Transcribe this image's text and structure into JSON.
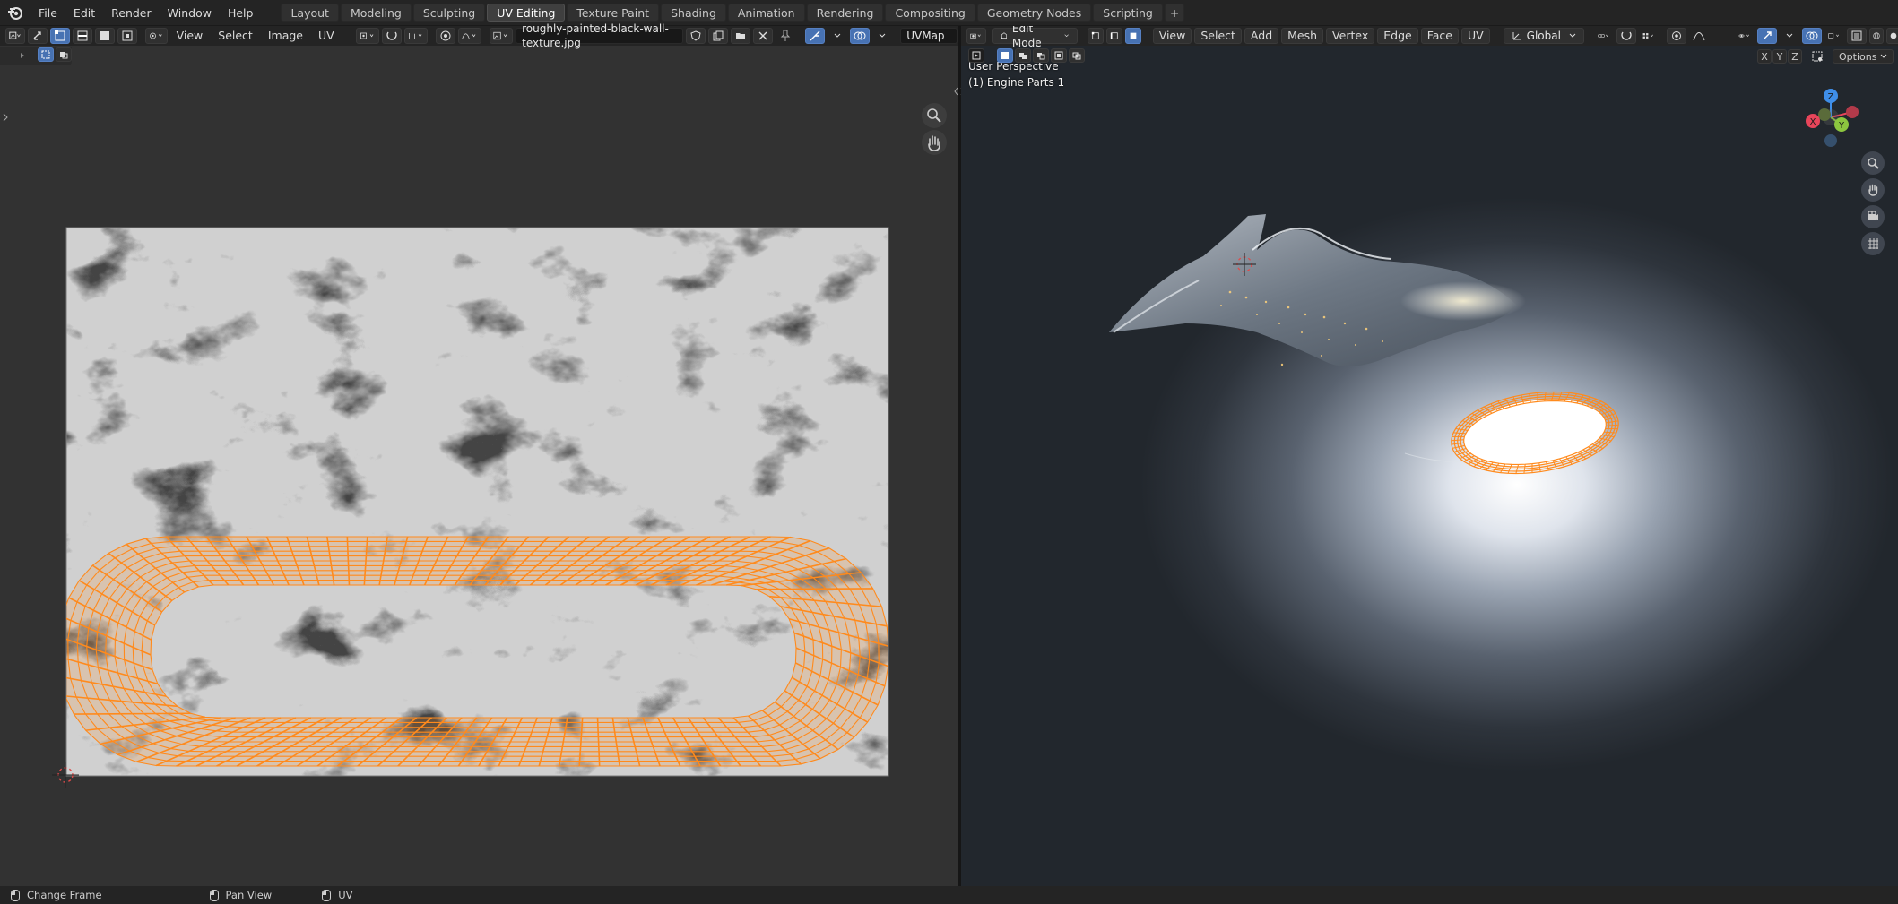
{
  "topbar": {
    "menu": [
      "File",
      "Edit",
      "Render",
      "Window",
      "Help"
    ],
    "tabs": [
      "Layout",
      "Modeling",
      "Sculpting",
      "UV Editing",
      "Texture Paint",
      "Shading",
      "Animation",
      "Rendering",
      "Compositing",
      "Geometry Nodes",
      "Scripting"
    ],
    "active_tab": "UV Editing",
    "add_tab": "+"
  },
  "uv_editor": {
    "menu": [
      "View",
      "Select",
      "Image",
      "UV"
    ],
    "image_name": "roughly-painted-black-wall-texture.jpg",
    "uvmap": "UVMap"
  },
  "viewport": {
    "mode": "Edit Mode",
    "menu": [
      "View",
      "Select",
      "Add",
      "Mesh",
      "Vertex",
      "Edge",
      "Face",
      "UV"
    ],
    "orientation": "Global",
    "perspective_label": "User Perspective",
    "object_label": "(1) Engine Parts 1",
    "axis_buttons": [
      "X",
      "Y",
      "Z"
    ],
    "options_label": "Options",
    "gizmo_axes": {
      "x": "X",
      "y": "Y",
      "z": "Z"
    }
  },
  "statusbar": {
    "items": [
      "Change Frame",
      "Pan View",
      "UV"
    ]
  },
  "colors": {
    "accent": "#4772b3",
    "uv_wire": "#ff8a1c",
    "axis_x": "#e8455a",
    "axis_y": "#8cc63f",
    "axis_z": "#3f8ee8"
  }
}
